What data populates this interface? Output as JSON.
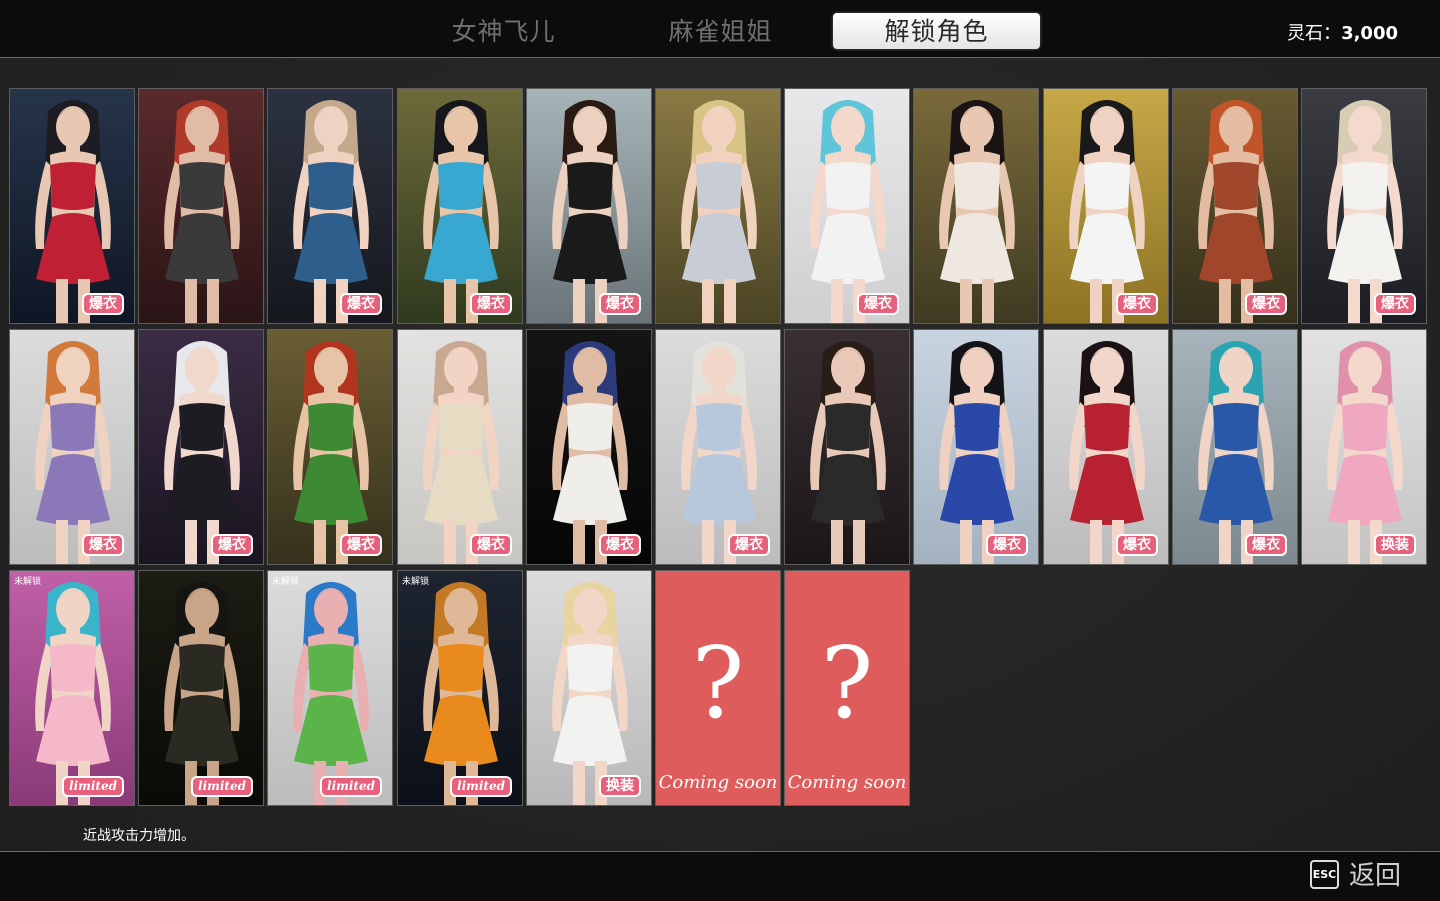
{
  "tabs": [
    {
      "label": "女神飞儿",
      "active": false
    },
    {
      "label": "麻雀姐姐",
      "active": false
    },
    {
      "label": "解锁角色",
      "active": true
    }
  ],
  "currency": {
    "label": "灵石：",
    "value": "3,000"
  },
  "colors": {
    "badge": "#e7607c",
    "coming_soon_card": "#de5c5c",
    "bar": "#0c0c0c"
  },
  "rows": [
    [
      {
        "badge": "爆衣",
        "bg": [
          "#26344a",
          "#0e1624"
        ],
        "hair": "#1c1c22",
        "outfit": "#c02034",
        "skin": "#e8c7b3"
      },
      {
        "badge": "",
        "bg": [
          "#5a2a2c",
          "#2a1416"
        ],
        "hair": "#b03a2a",
        "outfit": "#3a3a3a",
        "skin": "#e0bba5"
      },
      {
        "badge": "爆衣",
        "bg": [
          "#2c3240",
          "#15171d"
        ],
        "hair": "#c3a88c",
        "outfit": "#2e5e8c",
        "skin": "#f0d2c2"
      },
      {
        "badge": "爆衣",
        "bg": [
          "#6e6a3a",
          "#2e3a1e"
        ],
        "hair": "#15171c",
        "outfit": "#38a8d0",
        "skin": "#e8c4a8"
      },
      {
        "badge": "爆衣",
        "bg": [
          "#a6b4b8",
          "#6a7478"
        ],
        "hair": "#2a1a14",
        "outfit": "#1a1a1a",
        "skin": "#ecd0c0"
      },
      {
        "badge": "",
        "bg": [
          "#8a7a44",
          "#4a4424"
        ],
        "hair": "#d8c486",
        "outfit": "#c8ccd4",
        "skin": "#f0d2be"
      },
      {
        "badge": "爆衣",
        "bg": [
          "#e8e8ea",
          "#cfcfd2"
        ],
        "hair": "#5ec6d8",
        "outfit": "#f2f2f2",
        "skin": "#f4d8cc"
      },
      {
        "badge": "",
        "bg": [
          "#7a6a3a",
          "#3e3a22"
        ],
        "hair": "#1a1414",
        "outfit": "#efe8e0",
        "skin": "#e8c8b2"
      },
      {
        "badge": "爆衣",
        "bg": [
          "#c6a848",
          "#8c7224"
        ],
        "hair": "#1a1a1a",
        "outfit": "#f4f4f4",
        "skin": "#f0d2c2"
      },
      {
        "badge": "爆衣",
        "bg": [
          "#6a5a32",
          "#34301c"
        ],
        "hair": "#c2542a",
        "outfit": "#a0462a",
        "skin": "#e4bca2"
      },
      {
        "badge": "爆衣",
        "bg": [
          "#3a3c42",
          "#1c1d22"
        ],
        "hair": "#d8cdb4",
        "outfit": "#f4f2ee",
        "skin": "#f4dace"
      }
    ],
    [
      {
        "badge": "爆衣",
        "bg": [
          "#dcdcdc",
          "#bcbcbc"
        ],
        "hair": "#d27a3c",
        "outfit": "#8a78b8",
        "skin": "#f0d2c0"
      },
      {
        "badge": "爆衣",
        "bg": [
          "#3a2c44",
          "#1a1420"
        ],
        "hair": "#e8e8ec",
        "outfit": "#1c1c22",
        "skin": "#f0d8cc"
      },
      {
        "badge": "爆衣",
        "bg": [
          "#6a5e34",
          "#34301c"
        ],
        "hair": "#b0341e",
        "outfit": "#3e8a34",
        "skin": "#e8c4a6"
      },
      {
        "badge": "爆衣",
        "bg": [
          "#e4e2e0",
          "#c8c6c2"
        ],
        "hair": "#c8a890",
        "outfit": "#e6dcc4",
        "skin": "#f2d4c4"
      },
      {
        "badge": "爆衣",
        "bg": [
          "#141414",
          "#060606"
        ],
        "hair": "#2a3a7a",
        "outfit": "#f0eee8",
        "skin": "#e0bca4"
      },
      {
        "badge": "爆衣",
        "bg": [
          "#dcdcdc",
          "#bcbcbc"
        ],
        "hair": "#e4e2dc",
        "outfit": "#b8c8dc",
        "skin": "#f2d6ca"
      },
      {
        "badge": "",
        "bg": [
          "#3a3034",
          "#1a1618"
        ],
        "hair": "#2a1c16",
        "outfit": "#2a2a2a",
        "skin": "#e8c8b6"
      },
      {
        "badge": "爆衣",
        "bg": [
          "#c8d4e0",
          "#a4b2c0"
        ],
        "hair": "#141418",
        "outfit": "#2a48a8",
        "skin": "#f0d0c0"
      },
      {
        "badge": "爆衣",
        "bg": [
          "#dcdcdc",
          "#bcbcbc"
        ],
        "hair": "#1a1214",
        "outfit": "#b82230",
        "skin": "#f2d6ca"
      },
      {
        "badge": "爆衣",
        "bg": [
          "#a8b4bc",
          "#7c8890"
        ],
        "hair": "#2aa4b0",
        "outfit": "#2a58a8",
        "skin": "#f0d4c6"
      },
      {
        "badge": "换装",
        "bg": [
          "#e2e2e2",
          "#c4c4c4"
        ],
        "hair": "#e090a8",
        "outfit": "#f0a8c0",
        "skin": "#f4d8cc"
      }
    ],
    [
      {
        "badge": "limited",
        "top_tag": "未解锁",
        "bg": [
          "#c060a8",
          "#8a3a78"
        ],
        "hair": "#3ab4c8",
        "outfit": "#f4b8c8",
        "skin": "#f0d4c6"
      },
      {
        "badge": "limited",
        "bg": [
          "#1c1c14",
          "#0a0a06"
        ],
        "hair": "#141410",
        "outfit": "#2a2a22",
        "skin": "#c8a488"
      },
      {
        "badge": "limited",
        "top_tag": "未解锁",
        "bg": [
          "#dcdcdc",
          "#bcbcbc"
        ],
        "hair": "#2a7ac8",
        "outfit": "#5ab44a",
        "skin": "#e8b0b0"
      },
      {
        "badge": "limited",
        "top_tag": "未解锁",
        "bg": [
          "#1e2430",
          "#0c1018"
        ],
        "hair": "#c47a24",
        "outfit": "#e88a1c",
        "skin": "#e0b898"
      },
      {
        "badge": "换装",
        "bg": [
          "#dcdcdc",
          "#b8b8b8"
        ],
        "hair": "#e8d4a0",
        "outfit": "#f2f2f0",
        "skin": "#f2d6c8"
      },
      {
        "coming_soon": true,
        "q": "?",
        "text": "Coming soon"
      },
      {
        "coming_soon": true,
        "q": "?",
        "text": "Coming soon"
      }
    ]
  ],
  "description": "近战攻击力增加。",
  "footer": {
    "esc_key": "ESC",
    "back_label": "返回"
  }
}
